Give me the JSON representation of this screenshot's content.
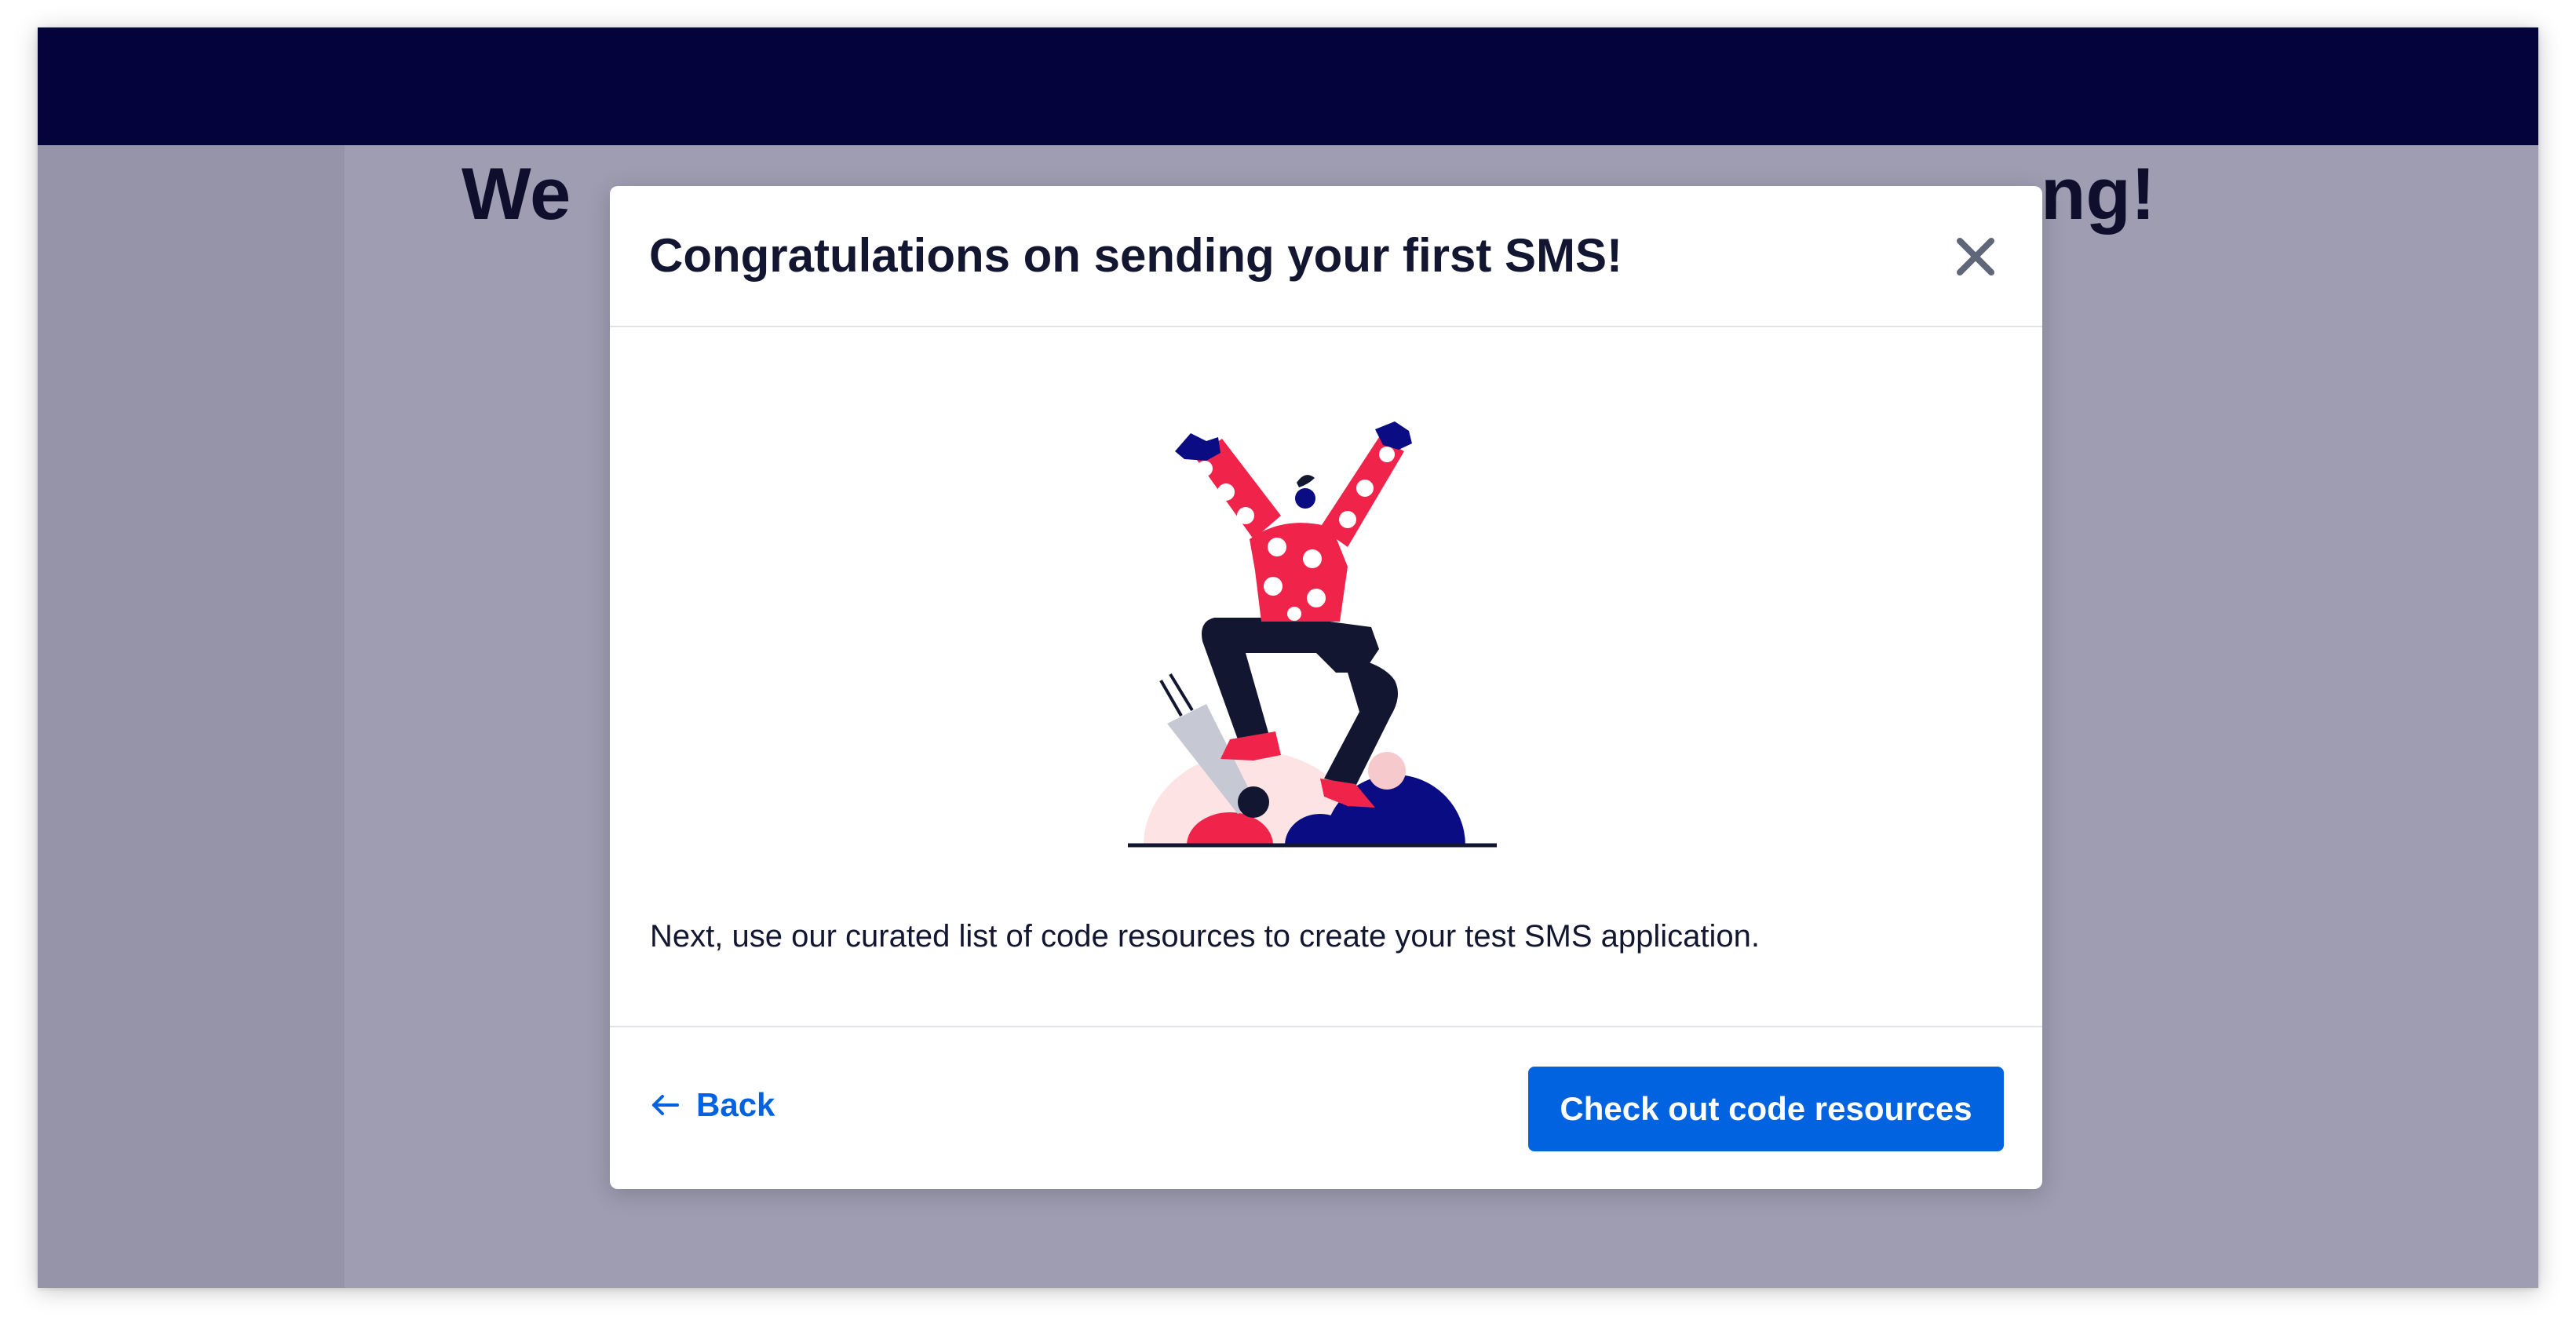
{
  "background": {
    "heading_left": "We",
    "heading_right": "ng!"
  },
  "modal": {
    "title": "Congratulations on sending your first SMS!",
    "close_icon": "close-icon",
    "illustration": "celebrating-person-illustration",
    "body_text": "Next, use our curated list of code resources to create your test SMS application.",
    "back_label": "Back",
    "back_icon": "arrow-left-icon",
    "primary_button_label": "Check out code resources"
  },
  "colors": {
    "topbar": "#05033b",
    "overlay": "#9e9db1",
    "primary": "#0263e0",
    "text": "#131630"
  }
}
